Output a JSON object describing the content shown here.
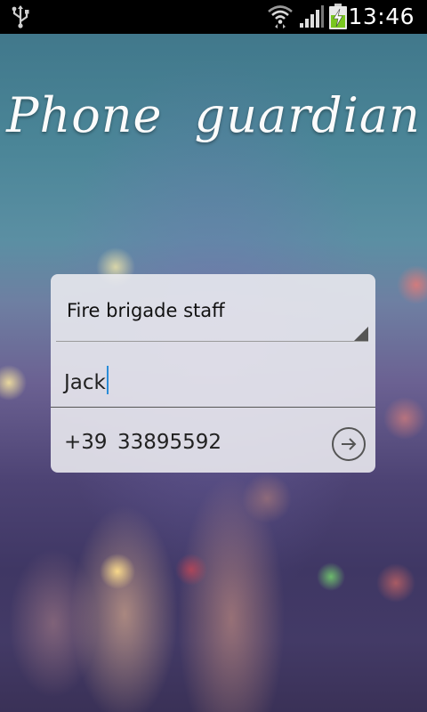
{
  "status_bar": {
    "time": "13:46",
    "icons": [
      "usb-icon",
      "wifi-icon",
      "signal-icon",
      "battery-charging-icon"
    ]
  },
  "app": {
    "title": "Phone guardian"
  },
  "form": {
    "category_selected": "Fire brigade staff",
    "name_value": "Jack",
    "phone_prefix": "+39",
    "phone_number": "33895592",
    "submit_icon": "arrow-right-circle-icon"
  }
}
